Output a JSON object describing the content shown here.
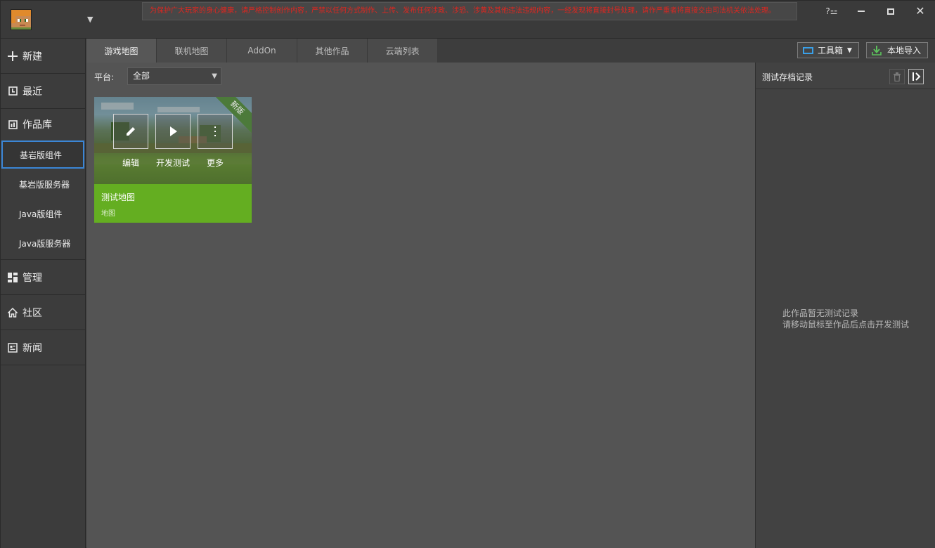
{
  "titlebar": {
    "notice": "为保护广大玩家的身心健康，请严格控制创作内容，严禁以任何方式制作、上传、发布任何涉政、涉恐、涉黄及其他违法违规内容，一经发现将直接封号处理，请作严重者将直接交由司法机关依法处理。",
    "help_label": "?⚍",
    "minimize_label": "",
    "close_label": "✕",
    "caret": "▼"
  },
  "sidebar": {
    "items": [
      {
        "label": "新建",
        "icon": "plus-icon"
      },
      {
        "label": "最近",
        "icon": "clock-icon"
      },
      {
        "label": "作品库",
        "icon": "library-icon"
      },
      {
        "label": "管理",
        "icon": "dashboard-icon"
      },
      {
        "label": "社区",
        "icon": "home-icon"
      },
      {
        "label": "新闻",
        "icon": "news-icon"
      }
    ],
    "library_sub": [
      {
        "label": "基岩版组件",
        "active": true
      },
      {
        "label": "基岩版服务器"
      },
      {
        "label": "Java版组件"
      },
      {
        "label": "Java版服务器"
      }
    ]
  },
  "tabs": [
    {
      "label": "游戏地图",
      "active": true
    },
    {
      "label": "联机地图"
    },
    {
      "label": "AddOn"
    },
    {
      "label": "其他作品"
    },
    {
      "label": "云端列表"
    }
  ],
  "toolbar": {
    "tools_label": "工具箱",
    "import_label": "本地导入"
  },
  "filter": {
    "platform_label": "平台:",
    "platform_value": "全部"
  },
  "card": {
    "ribbon": "新版",
    "edit_label": "编辑",
    "test_label": "开发测试",
    "more_label": "更多",
    "title": "测试地图",
    "type": "地图"
  },
  "right_panel": {
    "title": "测试存档记录",
    "empty_line1": "此作品暂无测试记录",
    "empty_line2": "请移动鼠标至作品后点击开发测试"
  },
  "colors": {
    "accent_blue": "#3b86d6",
    "card_green": "#64ae21",
    "notice_red": "#e0261f",
    "import_green": "#5cc05c"
  }
}
